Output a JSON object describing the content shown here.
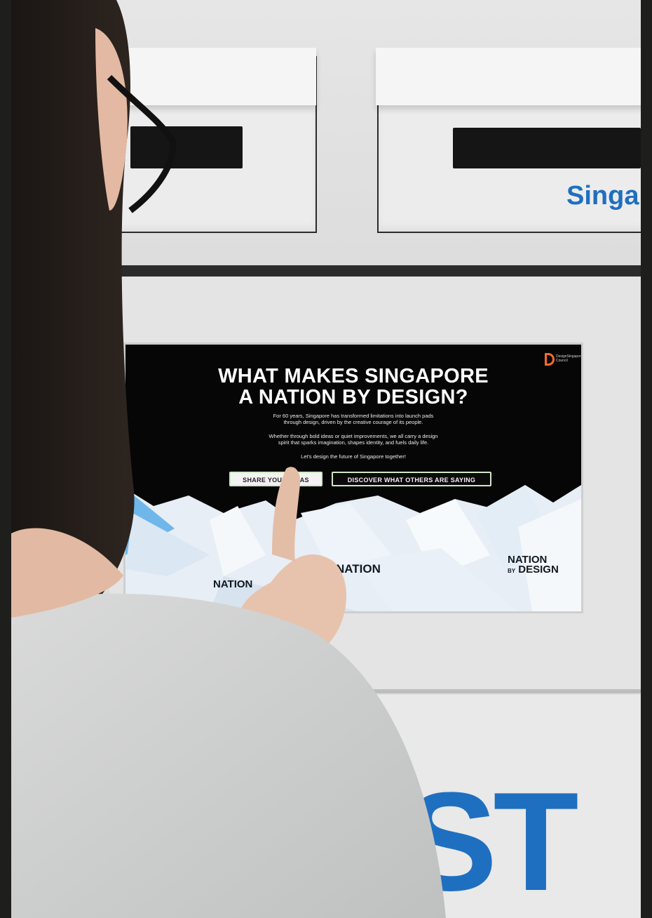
{
  "wall": {
    "brand_text": "Singap",
    "big_letters": "ST"
  },
  "screen": {
    "logo_text": "DesignSingapore Council",
    "title_line1": "WHAT MAKES SINGAPORE",
    "title_line2": "A NATION BY DESIGN?",
    "paragraph1_line1": "For 60 years, Singapore has transformed limitations into launch pads",
    "paragraph1_line2": "through design, driven by the creative courage of its people.",
    "paragraph2_line1": "Whether through bold ideas or quiet improvements, we all carry a design",
    "paragraph2_line2": "spirit that sparks imagination, shapes identity, and fuels daily life.",
    "paragraph3": "Let's design the future of Singapore together!",
    "share_button": "SHARE YOUR IDEAS",
    "discover_button": "DISCOVER WHAT OTHERS ARE SAYING",
    "nbd_mark_big": "NATION",
    "nbd_mark_by": "BY",
    "nbd_mark_design": "DESIGN"
  },
  "colors": {
    "accent_blue": "#1f6fc0",
    "logo_orange": "#ff6a2b",
    "button_outline": "#cfe8c6"
  }
}
